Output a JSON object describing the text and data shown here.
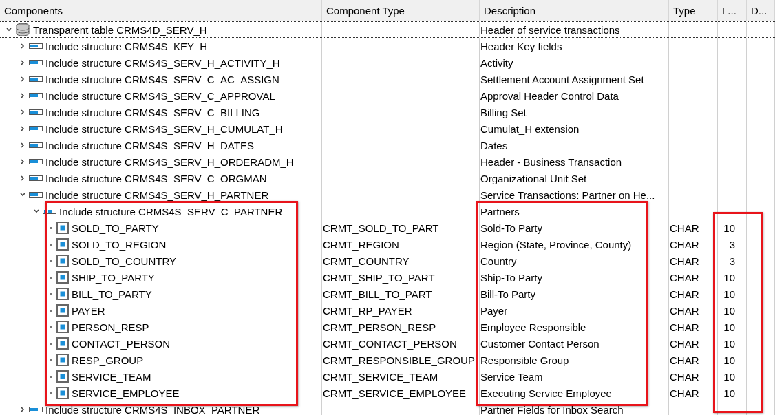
{
  "columns": [
    "Components",
    "Component Type",
    "Description",
    "Type",
    "L...",
    "D..."
  ],
  "tree": [
    {
      "kind": "table",
      "label": "Transparent table CRMS4D_SERV_H",
      "description": "Header of service transactions",
      "expanded": true,
      "children": [
        {
          "kind": "include",
          "label": "Include structure CRMS4S_KEY_H",
          "description": "Header Key fields",
          "expanded": false
        },
        {
          "kind": "include",
          "label": "Include structure CRMS4S_SERV_H_ACTIVITY_H",
          "description": "Activity",
          "expanded": false
        },
        {
          "kind": "include",
          "label": "Include structure CRMS4S_SERV_C_AC_ASSIGN",
          "description": "Settlement Account Assignment Set",
          "expanded": false
        },
        {
          "kind": "include",
          "label": "Include structure CRMS4S_SERV_C_APPROVAL",
          "description": "Approval Header Control Data",
          "expanded": false
        },
        {
          "kind": "include",
          "label": "Include structure CRMS4S_SERV_C_BILLING",
          "description": "Billing Set",
          "expanded": false
        },
        {
          "kind": "include",
          "label": "Include structure CRMS4S_SERV_H_CUMULAT_H",
          "description": "Cumulat_H extension",
          "expanded": false
        },
        {
          "kind": "include",
          "label": "Include structure CRMS4S_SERV_H_DATES",
          "description": "Dates",
          "expanded": false
        },
        {
          "kind": "include",
          "label": "Include structure CRMS4S_SERV_H_ORDERADM_H",
          "description": "Header - Business Transaction",
          "expanded": false
        },
        {
          "kind": "include",
          "label": "Include structure CRMS4S_SERV_C_ORGMAN",
          "description": "Organizational Unit Set",
          "expanded": false
        },
        {
          "kind": "include",
          "label": "Include structure CRMS4S_SERV_H_PARTNER",
          "description": "Service Transactions: Partner on He...",
          "expanded": true,
          "children": [
            {
              "kind": "include",
              "label": "Include structure CRMS4S_SERV_C_PARTNER",
              "description": "Partners",
              "expanded": true,
              "children": [
                {
                  "kind": "field",
                  "label": "SOLD_TO_PARTY",
                  "component_type": "CRMT_SOLD_TO_PART",
                  "description": "Sold-To Party",
                  "type": "CHAR",
                  "length": "10"
                },
                {
                  "kind": "field",
                  "label": "SOLD_TO_REGION",
                  "component_type": "CRMT_REGION",
                  "description": "Region (State, Province, County)",
                  "type": "CHAR",
                  "length": "3"
                },
                {
                  "kind": "field",
                  "label": "SOLD_TO_COUNTRY",
                  "component_type": "CRMT_COUNTRY",
                  "description": "Country",
                  "type": "CHAR",
                  "length": "3"
                },
                {
                  "kind": "field",
                  "label": "SHIP_TO_PARTY",
                  "component_type": "CRMT_SHIP_TO_PART",
                  "description": "Ship-To Party",
                  "type": "CHAR",
                  "length": "10"
                },
                {
                  "kind": "field",
                  "label": "BILL_TO_PARTY",
                  "component_type": "CRMT_BILL_TO_PART",
                  "description": "Bill-To Party",
                  "type": "CHAR",
                  "length": "10"
                },
                {
                  "kind": "field",
                  "label": "PAYER",
                  "component_type": "CRMT_RP_PAYER",
                  "description": "Payer",
                  "type": "CHAR",
                  "length": "10"
                },
                {
                  "kind": "field",
                  "label": "PERSON_RESP",
                  "component_type": "CRMT_PERSON_RESP",
                  "description": "Employee Responsible",
                  "type": "CHAR",
                  "length": "10"
                },
                {
                  "kind": "field",
                  "label": "CONTACT_PERSON",
                  "component_type": "CRMT_CONTACT_PERSON",
                  "description": "Customer Contact Person",
                  "type": "CHAR",
                  "length": "10"
                },
                {
                  "kind": "field",
                  "label": "RESP_GROUP",
                  "component_type": "CRMT_RESPONSIBLE_GROUP",
                  "description": "Responsible Group",
                  "type": "CHAR",
                  "length": "10"
                },
                {
                  "kind": "field",
                  "label": "SERVICE_TEAM",
                  "component_type": "CRMT_SERVICE_TEAM",
                  "description": "Service Team",
                  "type": "CHAR",
                  "length": "10"
                },
                {
                  "kind": "field",
                  "label": "SERVICE_EMPLOYEE",
                  "component_type": "CRMT_SERVICE_EMPLOYEE",
                  "description": "Executing Service Employee",
                  "type": "CHAR",
                  "length": "10"
                }
              ]
            }
          ]
        },
        {
          "kind": "include",
          "label": "Include structure CRMS4S_INBOX_PARTNER",
          "description": "Partner Fields for Inbox Search",
          "expanded": false
        }
      ]
    }
  ]
}
